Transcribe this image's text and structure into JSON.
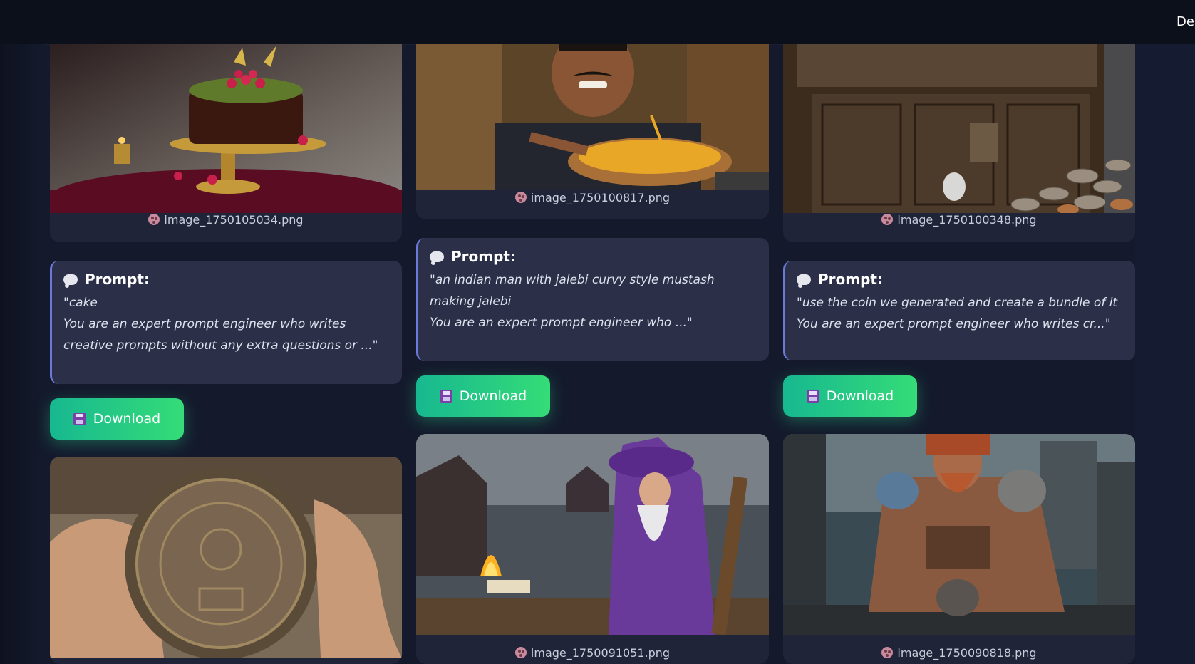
{
  "topbar": {
    "nav_label": "Dep"
  },
  "colors": {
    "accent_gradient_start": "#17b890",
    "accent_gradient_end": "#35dc77",
    "card_bg": "#1f2438",
    "prompt_border": "#6a7ad8"
  },
  "prompt_header": "Prompt:",
  "download_label": "Download",
  "gallery": [
    {
      "file": "image_1750105034.png",
      "prompt": "\"cake\nYou are an expert prompt engineer who writes creative prompts without any extra questions or ...\""
    },
    {
      "file": "image_1750100817.png",
      "prompt": "\"an indian man with jalebi curvy style mustash making jalebi\nYou are an expert prompt engineer who ...\""
    },
    {
      "file": "image_1750100348.png",
      "prompt": "\"use the coin we generated and create a bundle of it\nYou are an expert prompt engineer who writes cr...\""
    },
    {
      "file": "image_1750091051.png"
    },
    {
      "file": "image_1750090818.png"
    }
  ],
  "icons": {
    "file": "palette-icon",
    "prompt": "thought-bubble-icon",
    "download": "floppy-disk-icon"
  }
}
